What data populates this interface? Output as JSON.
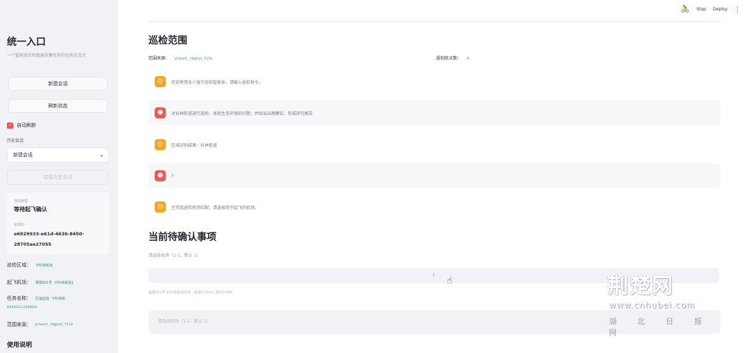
{
  "sidebar": {
    "title": "统一入口",
    "subtitle": "一个智能巡检和数据采集任务的任务交互台",
    "new_session_label": "新建会话",
    "refresh_status_label": "刷新状态",
    "auto_refresh_label": "自动刷新",
    "auto_refresh_checked": true,
    "history_label": "历史会话",
    "history_selected": "新建会话",
    "load_history_label": "加载历史会话",
    "status_card": {
      "status_label": "当前状态",
      "status_value": "等待起飞确认",
      "session_label": "会话ID",
      "session_id": "e6929933-e61d-4636-8450-28705ae27055"
    },
    "patrol_area_label": "巡检区域：",
    "patrol_area_value": "卡科林街道",
    "takeoff_label": "起飞机场：",
    "takeoff_value": "鹭鸶001号 卡科林街道1",
    "task_name_label": "任务名称：",
    "task_name_value": "区域巡检 卡科林街",
    "task_code": "DR2025112209001",
    "source_label": "范围来源：",
    "source_value": "preset_region_file",
    "usage_heading": "使用说明"
  },
  "toolbar": {
    "stop_label": "Stop",
    "deploy_label": "Deploy",
    "menu_icon": "⋮",
    "run_icon": "🚴"
  },
  "main": {
    "title": "巡检范围",
    "source_label": "范围来源：",
    "source_value": "preset_region_file",
    "waypoints_label": "规划航点数：",
    "waypoints_value": "4",
    "messages": [
      {
        "role": "assistant",
        "avatar": "☺",
        "text": "欢迎使用无人值守巡检智能体，请输入巡检指令。"
      },
      {
        "role": "user",
        "avatar": "☻",
        "text": "对长林街道进行巡检，发现生态环保的问题，并给出治理建议，形成研究报告"
      },
      {
        "role": "assistant",
        "avatar": "☺",
        "text": "区域识别结果：长林街道"
      },
      {
        "role": "user",
        "avatar": "☻",
        "text": "Y"
      },
      {
        "role": "assistant",
        "avatar": "☺",
        "text": "已完成巡检机场匹配，请选择用于起飞的机场。"
      }
    ],
    "pending_title": "当前待确认事项",
    "input_label": "请选择机场（1-1，默认 1）",
    "input_value": "1",
    "help_text": "提醒001号 长科林街道机场（距离0.5km）置信0.999",
    "chat_placeholder": "请选择机场（1-1，默认 1）"
  },
  "watermark": {
    "main": "荆楚网",
    "url": "www.cnhubei.com",
    "chars": "湖北日报网"
  }
}
